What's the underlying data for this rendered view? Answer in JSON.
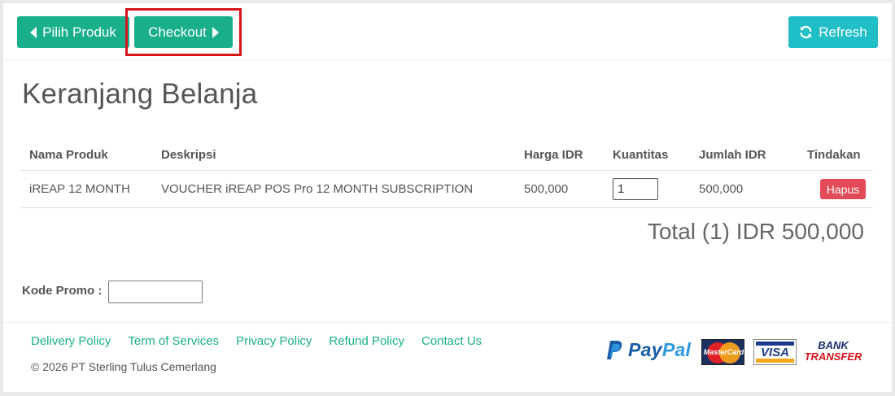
{
  "toolbar": {
    "back_label": "Pilih Produk",
    "checkout_label": "Checkout",
    "refresh_label": "Refresh"
  },
  "page_title": "Keranjang Belanja",
  "table": {
    "headers": [
      "Nama Produk",
      "Deskripsi",
      "Harga IDR",
      "Kuantitas",
      "Jumlah IDR",
      "Tindakan"
    ],
    "rows": [
      {
        "name": "iREAP 12 MONTH",
        "description": "VOUCHER iREAP POS Pro 12 MONTH SUBSCRIPTION",
        "price": "500,000",
        "quantity": "1",
        "amount": "500,000",
        "action": "Hapus"
      }
    ]
  },
  "total": "Total (1) IDR 500,000",
  "promo": {
    "label": "Kode Promo :",
    "value": ""
  },
  "footer": {
    "links": [
      "Delivery Policy",
      "Term of Services",
      "Privacy Policy",
      "Refund Policy",
      "Contact Us"
    ],
    "copyright": "© 2026 PT Sterling Tulus Cemerlang",
    "payments": {
      "paypal_a": "Pay",
      "paypal_b": "Pal",
      "mastercard": "MasterCard",
      "visa": "VISA",
      "bank_1": "BANK",
      "bank_2": "TRANSFER"
    }
  },
  "colors": {
    "primary": "#1aaf8b",
    "refresh": "#20bfc8",
    "danger": "#e24a57",
    "highlight": "#d9151b"
  }
}
